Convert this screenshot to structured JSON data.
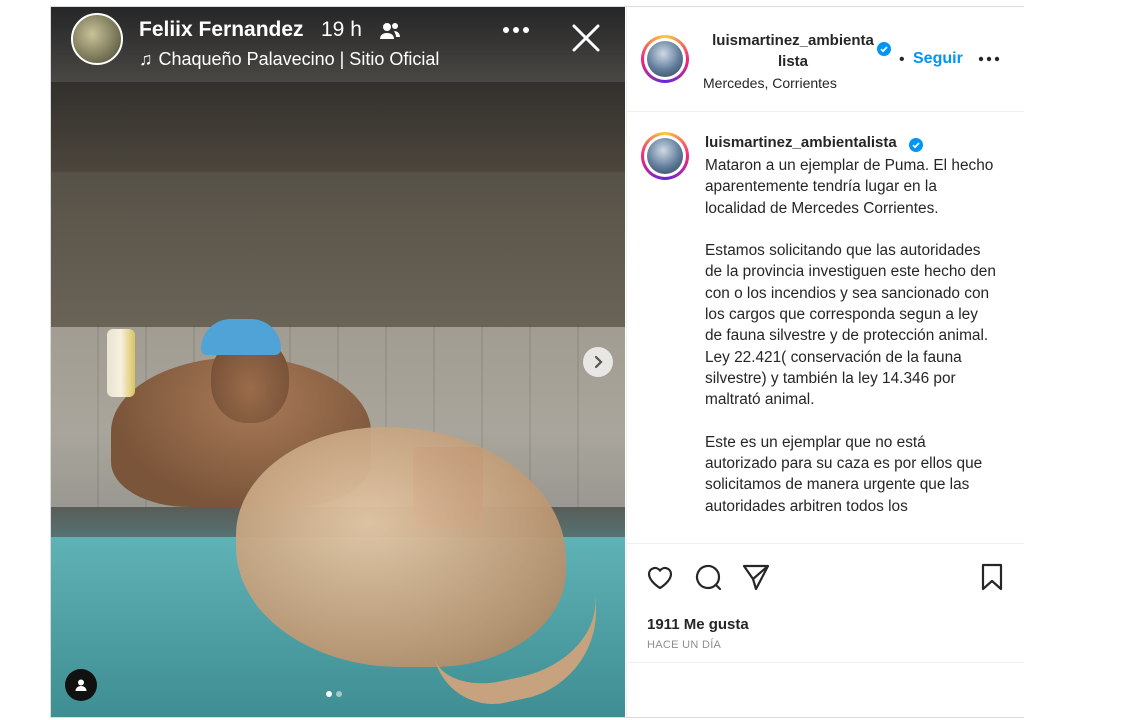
{
  "story": {
    "author": "Feliix Fernandez",
    "time": "19 h",
    "music": "Chaqueño Palavecino | Sitio Oficial",
    "icons": {
      "friends": "friends-icon",
      "music": "music-note-icon",
      "more": "more-icon",
      "close": "close-icon",
      "next": "chevron-right-icon",
      "tag": "user-tag-icon"
    },
    "carousel": {
      "count": 2,
      "active": 1
    }
  },
  "post": {
    "header": {
      "username_line1": "luismartinez_ambienta",
      "username_line2": "lista",
      "dot": "•",
      "follow_label": "Seguir",
      "location": "Mercedes, Corrientes"
    },
    "caption": {
      "username": "luismartinez_ambientalista",
      "text": "Mataron a un ejemplar de Puma. El hecho aparentemente tendría lugar en la localidad de Mercedes Corrientes.\n\nEstamos solicitando que las autoridades de la provincia investiguen este hecho den con o los incendios y sea sancionado con los cargos que corresponda segun a ley de fauna silvestre y de protección animal. Ley 22.421( conservación de la fauna silvestre) y también la ley 14.346 por maltrató animal.\n\nEste es un ejemplar que no está autorizado para su caza es por ellos que solicitamos de manera urgente que las autoridades arbitren todos los"
    },
    "likes": "1911 Me gusta",
    "timestamp": "HACE UN DÍA",
    "colors": {
      "follow": "#0095f6",
      "verified": "#0095f6",
      "text": "#262626",
      "muted": "#8e8e8e"
    }
  }
}
